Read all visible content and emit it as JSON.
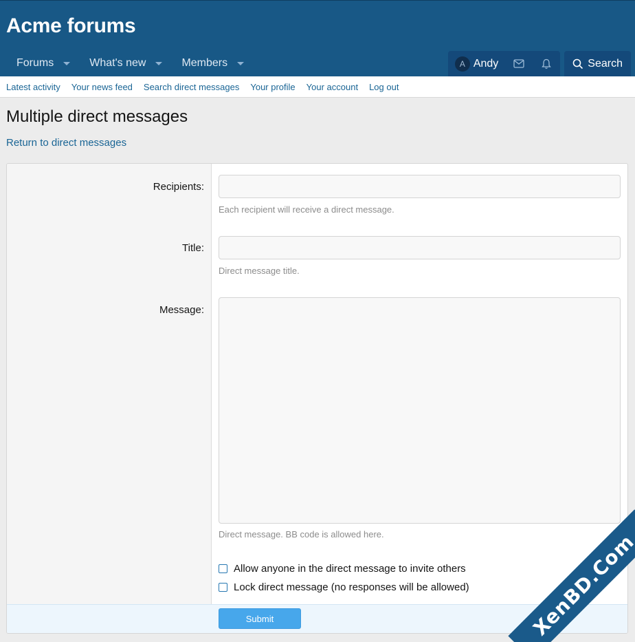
{
  "site": {
    "title": "Acme forums"
  },
  "nav": {
    "tabs": [
      {
        "label": "Forums",
        "has_menu": true
      },
      {
        "label": "What's new",
        "has_menu": true
      },
      {
        "label": "Members",
        "has_menu": true
      }
    ],
    "user": {
      "initial": "A",
      "name": "Andy"
    },
    "search_label": "Search"
  },
  "subnav": [
    "Latest activity",
    "Your news feed",
    "Search direct messages",
    "Your profile",
    "Your account",
    "Log out"
  ],
  "page": {
    "title": "Multiple direct messages",
    "back_link": "Return to direct messages"
  },
  "form": {
    "recipients": {
      "label": "Recipients:",
      "value": "",
      "hint": "Each recipient will receive a direct message."
    },
    "title": {
      "label": "Title:",
      "value": "",
      "hint": "Direct message title."
    },
    "message": {
      "label": "Message:",
      "value": "",
      "hint": "Direct message. BB code is allowed here."
    },
    "options": [
      {
        "label": "Allow anyone in the direct message to invite others",
        "checked": false
      },
      {
        "label": "Lock direct message (no responses will be allowed)",
        "checked": false
      }
    ],
    "submit_label": "Submit"
  },
  "watermark": "XenBD.Com",
  "colors": {
    "header": "#185886",
    "link": "#1a6595",
    "button": "#47a7eb"
  }
}
